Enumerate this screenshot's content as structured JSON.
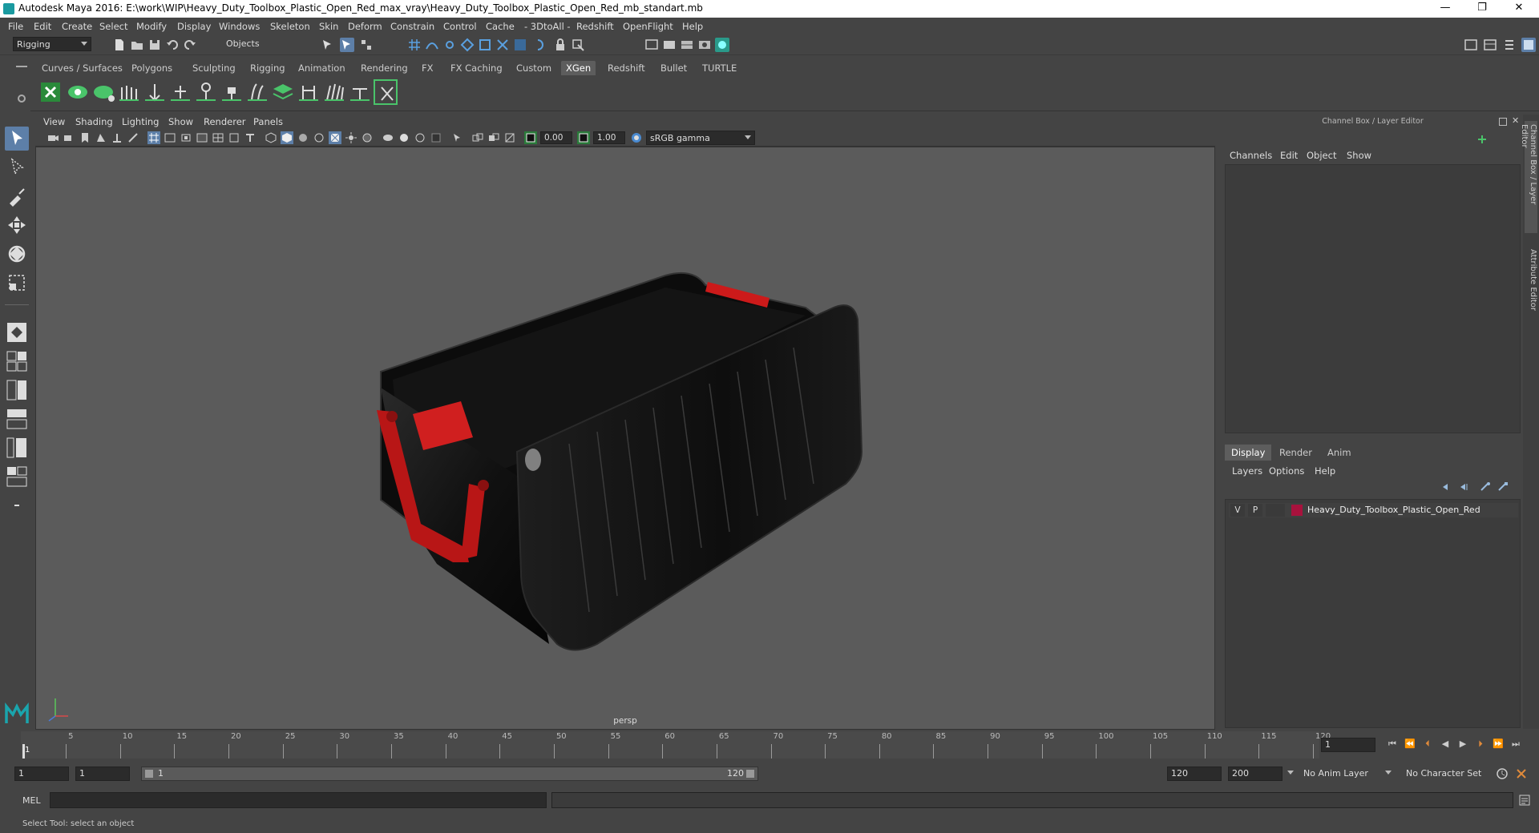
{
  "titlebar": {
    "title": "Autodesk Maya 2016: E:\\work\\WIP\\Heavy_Duty_Toolbox_Plastic_Open_Red_max_vray\\Heavy_Duty_Toolbox_Plastic_Open_Red_mb_standart.mb",
    "minimize": "—",
    "restore": "❐",
    "close": "✕"
  },
  "menubar": [
    "File",
    "Edit",
    "Create",
    "Select",
    "Modify",
    "Display",
    "Windows",
    "Skeleton",
    "Skin",
    "Deform",
    "Constrain",
    "Control",
    "Cache",
    "- 3DtoAll -",
    "Redshift",
    "OpenFlight",
    "Help"
  ],
  "statusline": {
    "mode": "Rigging",
    "selection_mode": "Objects"
  },
  "shelf_tabs": {
    "items": [
      "Curves / Surfaces",
      "Polygons",
      "Sculpting",
      "Rigging",
      "Animation",
      "Rendering",
      "FX",
      "FX Caching",
      "Custom",
      "XGen",
      "Redshift",
      "Bullet",
      "TURTLE"
    ],
    "active": "XGen"
  },
  "viewport": {
    "menus": [
      "View",
      "Shading",
      "Lighting",
      "Show",
      "Renderer",
      "Panels"
    ],
    "exposure": "0.00",
    "gamma": "1.00",
    "color_space": "sRGB gamma",
    "camera_label": "persp"
  },
  "channel_box": {
    "header": "Channel Box / Layer Editor",
    "menus": [
      "Channels",
      "Edit",
      "Object",
      "Show"
    ]
  },
  "layer_editor": {
    "tabs": [
      "Display",
      "Render",
      "Anim"
    ],
    "active_tab": "Display",
    "menus": [
      "Layers",
      "Options",
      "Help"
    ],
    "layers": [
      {
        "visible": "V",
        "playback": "P",
        "name": "Heavy_Duty_Toolbox_Plastic_Open_Red",
        "color": "#a8123d"
      }
    ]
  },
  "side_tabs": [
    "Channel Box / Layer Editor",
    "Attribute Editor"
  ],
  "time_slider": {
    "labels": [
      "1",
      "5",
      "10",
      "15",
      "20",
      "25",
      "30",
      "35",
      "40",
      "45",
      "50",
      "55",
      "60",
      "65",
      "70",
      "75",
      "80",
      "85",
      "90",
      "95",
      "100",
      "105",
      "110",
      "115",
      "120"
    ],
    "current_frame": "1"
  },
  "range_slider": {
    "start": "1",
    "playback_start": "1",
    "range_start_label": "1",
    "range_end_label": "120",
    "playback_end": "120",
    "end": "200",
    "anim_layer": "No Anim Layer",
    "character_set": "No Character Set"
  },
  "command_line": {
    "label": "MEL"
  },
  "help_line": {
    "text": "Select Tool: select an object"
  },
  "colors": {
    "accent_active_tab": "#5d5d5d",
    "layer_swatch": "#a8123d",
    "toolbox_handle": "#cc1a1a",
    "toolbox_body": "#121212"
  }
}
